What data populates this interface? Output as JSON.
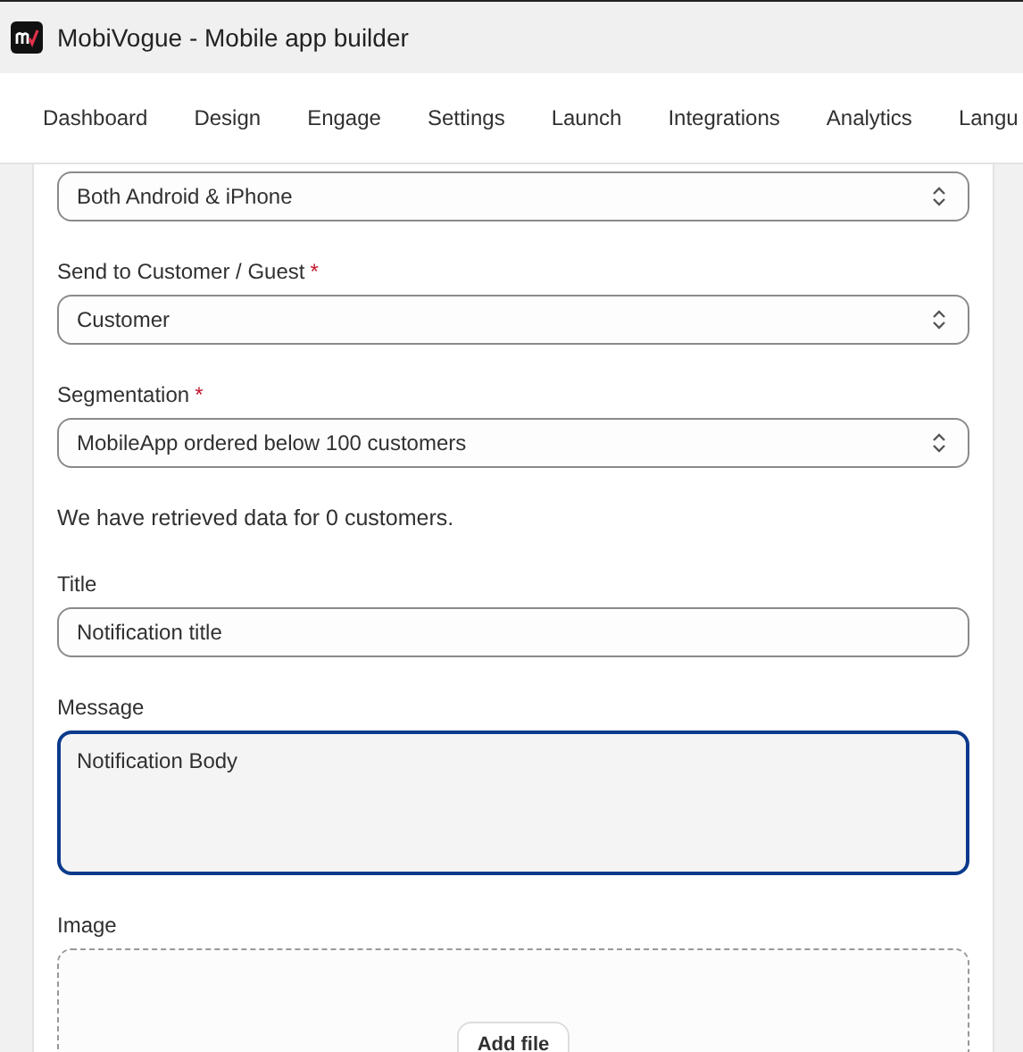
{
  "window": {
    "title": "MobiVogue - Mobile app builder"
  },
  "nav": {
    "tabs": [
      {
        "label": "Dashboard"
      },
      {
        "label": "Design"
      },
      {
        "label": "Engage"
      },
      {
        "label": "Settings"
      },
      {
        "label": "Launch"
      },
      {
        "label": "Integrations"
      },
      {
        "label": "Analytics"
      },
      {
        "label": "Langu"
      }
    ]
  },
  "form": {
    "fields": [
      {
        "kind": "select",
        "value": "Both Android & iPhone"
      },
      {
        "kind": "select",
        "label": "Send to Customer / Guest",
        "required_mark": "*",
        "value": "Customer"
      },
      {
        "kind": "select",
        "label": "Segmentation",
        "required_mark": "*",
        "value": "MobileApp ordered below 100 customers"
      },
      {
        "kind": "note",
        "text": "We have retrieved data for 0 customers."
      },
      {
        "kind": "text",
        "label": "Title",
        "value": "Notification title",
        "focused": false
      },
      {
        "kind": "textarea",
        "label": "Message",
        "value": "Notification Body",
        "focused": true
      },
      {
        "kind": "file",
        "label": "Image",
        "button": "Add file"
      }
    ]
  }
}
